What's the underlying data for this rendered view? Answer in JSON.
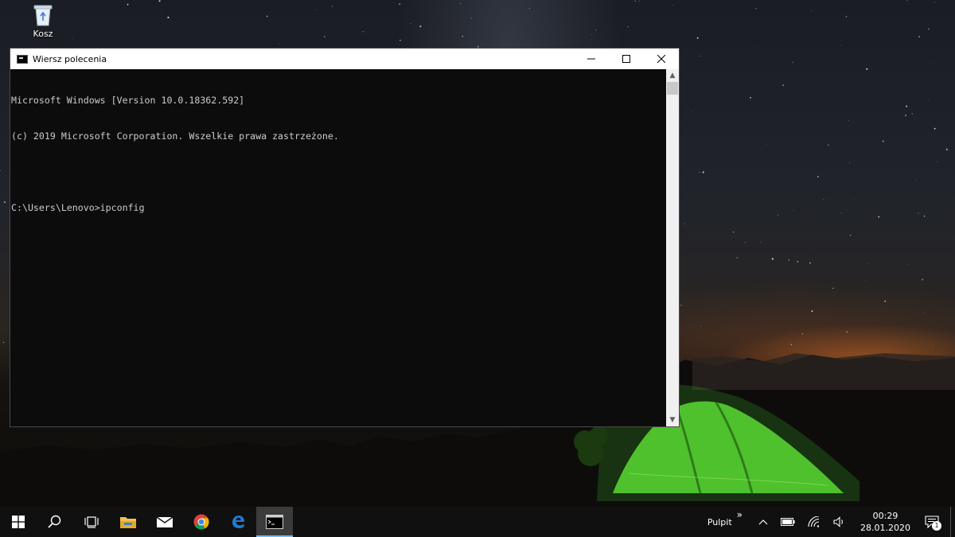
{
  "desktop": {
    "icons": [
      {
        "label": "Kosz",
        "icon": "recycle-bin-icon"
      }
    ]
  },
  "window": {
    "title": "Wiersz polecenia",
    "icon": "cmd-icon",
    "controls": {
      "minimize": "—",
      "maximize": "☐",
      "close": "✕"
    },
    "console_lines": [
      "Microsoft Windows [Version 10.0.18362.592]",
      "(c) 2019 Microsoft Corporation. Wszelkie prawa zastrzeżone.",
      "",
      "C:\\Users\\Lenovo>ipconfig"
    ],
    "scroll_up": "▲",
    "scroll_down": "▼"
  },
  "taskbar": {
    "apps": [
      {
        "name": "start",
        "icon": "windows-logo-icon"
      },
      {
        "name": "search",
        "icon": "search-icon"
      },
      {
        "name": "task-view",
        "icon": "task-view-icon"
      },
      {
        "name": "file-explorer",
        "icon": "folder-icon"
      },
      {
        "name": "mail",
        "icon": "mail-icon"
      },
      {
        "name": "chrome",
        "icon": "chrome-icon"
      },
      {
        "name": "edge",
        "icon": "edge-icon"
      },
      {
        "name": "command-prompt",
        "icon": "cmd-icon",
        "active": true
      }
    ],
    "tray": {
      "desktop_label": "Pulpit",
      "chevron": "»",
      "time": "00:29",
      "date": "28.01.2020",
      "notifications_count": "1"
    },
    "accent_color": "#76b9ed"
  }
}
